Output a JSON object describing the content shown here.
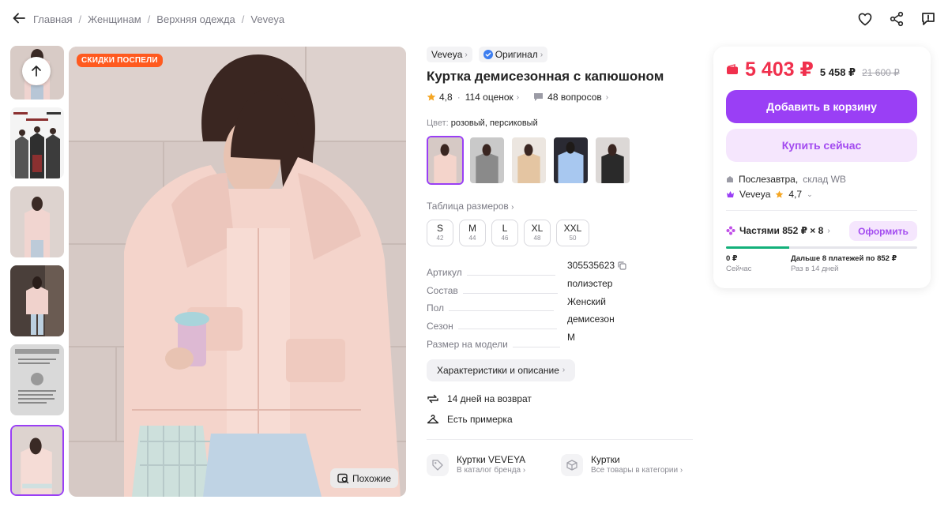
{
  "breadcrumb": [
    "Главная",
    "Женщинам",
    "Верхняя одежда",
    "Veveya"
  ],
  "icons": [
    "back-arrow-icon",
    "heart-icon",
    "share-icon",
    "report-icon",
    "arrow-up-icon",
    "search-similar-icon",
    "star-icon",
    "question-icon",
    "copy-icon",
    "return-icon",
    "hanger-icon",
    "tag-icon",
    "box-icon",
    "wallet-icon",
    "warehouse-icon",
    "crown-icon",
    "installment-icon",
    "verified-icon"
  ],
  "photo": {
    "badge": "СКИДКИ ПОСПЕЛИ",
    "similar_label": "Похожие"
  },
  "product": {
    "brand": "Veveya",
    "original": "Оригинал",
    "title": "Куртка демисезонная с капюшоном",
    "rating": "4,8",
    "reviews": "114 оценок",
    "questions": "48 вопросов",
    "color_label": "Цвет:",
    "color_value": "розовый, персиковый",
    "size_table": "Таблица размеров",
    "sizes": [
      {
        "label": "S",
        "ru": "42"
      },
      {
        "label": "M",
        "ru": "44"
      },
      {
        "label": "L",
        "ru": "46"
      },
      {
        "label": "XL",
        "ru": "48"
      },
      {
        "label": "XXL",
        "ru": "50"
      }
    ],
    "specs": [
      {
        "key": "Артикул",
        "value": "305535623"
      },
      {
        "key": "Состав",
        "value": "полиэстер"
      },
      {
        "key": "Пол",
        "value": "Женский"
      },
      {
        "key": "Сезон",
        "value": "демисезон"
      },
      {
        "key": "Размер на модели",
        "value": "M"
      }
    ],
    "desc_button": "Характеристики и описание",
    "features": [
      "14 дней на возврат",
      "Есть примерка"
    ],
    "links": [
      {
        "title": "Куртки VEVEYA",
        "sub": "В каталог бренда"
      },
      {
        "title": "Куртки",
        "sub": "Все товары в категории"
      }
    ]
  },
  "card": {
    "price": "5 403 ₽",
    "price_old": "5 458 ₽",
    "price_strike": "21 600 ₽",
    "add_to_cart": "Добавить в корзину",
    "buy_now": "Купить сейчас",
    "delivery_day": "Послезавтра,",
    "delivery_place": "склад WB",
    "seller": "Veveya",
    "seller_rating": "4,7",
    "installment": "Частями 852 ₽ × 8",
    "order_button": "Оформить",
    "installment_progress": 0.33,
    "now_amount": "0 ₽",
    "now_label": "Сейчас",
    "later_amount": "Дальше 8 платежей по 852 ₽",
    "later_label": "Раз в 14 дней"
  },
  "colors": {
    "accent": "#9a3ff5",
    "price": "#f0304d",
    "badge": "#ff5a1f",
    "success": "#13b07a"
  }
}
